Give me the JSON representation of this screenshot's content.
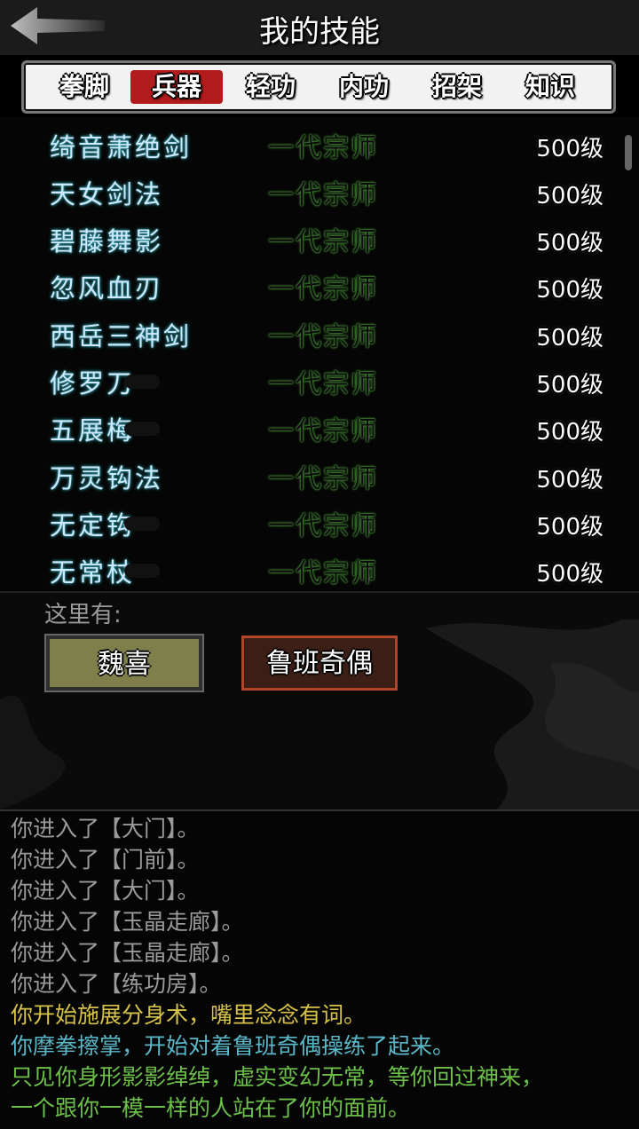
{
  "header": {
    "title": "我的技能",
    "back_icon": "back-arrow-icon"
  },
  "tabs": [
    {
      "label": "拳脚",
      "active": false
    },
    {
      "label": "兵器",
      "active": true
    },
    {
      "label": "轻功",
      "active": false
    },
    {
      "label": "内功",
      "active": false
    },
    {
      "label": "招架",
      "active": false
    },
    {
      "label": "知识",
      "active": false
    }
  ],
  "skills": [
    {
      "name": "绮音萧绝剑",
      "rank": "一代宗师",
      "level": "500级"
    },
    {
      "name": "天女剑法",
      "rank": "一代宗师",
      "level": "500级"
    },
    {
      "name": "碧藤舞影",
      "rank": "一代宗师",
      "level": "500级"
    },
    {
      "name": "忽风血刃",
      "rank": "一代宗师",
      "level": "500级"
    },
    {
      "name": "西岳三神剑",
      "rank": "一代宗师",
      "level": "500级"
    },
    {
      "name": "修罗刀",
      "rank": "一代宗师",
      "level": "500级"
    },
    {
      "name": "五展梅",
      "rank": "一代宗师",
      "level": "500级"
    },
    {
      "name": "万灵钩法",
      "rank": "一代宗师",
      "level": "500级"
    },
    {
      "name": "无定钩",
      "rank": "一代宗师",
      "level": "500级"
    },
    {
      "name": "无常杖",
      "rank": "一代宗师",
      "level": "500级"
    }
  ],
  "scene": {
    "label": "这里有:",
    "npcs": [
      "魏喜",
      "鲁班奇偶"
    ]
  },
  "log": [
    {
      "text": "你进入了【大门】。",
      "color": "#9a9a9a"
    },
    {
      "text": "你进入了【门前】。",
      "color": "#9a9a9a"
    },
    {
      "text": "你进入了【大门】。",
      "color": "#9a9a9a"
    },
    {
      "text": "你进入了【玉晶走廊】。",
      "color": "#9a9a9a"
    },
    {
      "text": "你进入了【玉晶走廊】。",
      "color": "#9a9a9a"
    },
    {
      "text": "你进入了【练功房】。",
      "color": "#9a9a9a"
    },
    {
      "text": "你开始施展分身术，嘴里念念有词。",
      "color": "#d6c24a"
    },
    {
      "text": "你摩拳擦掌，开始对着鲁班奇偶操练了起来。",
      "color": "#5ab8c8"
    },
    {
      "text": "只见你身形影影绰绰，虚实变幻无常，等你回过神来，",
      "color": "#6cc04a"
    },
    {
      "text": "一个跟你一模一样的人站在了你的面前。",
      "color": "#6cc04a"
    }
  ]
}
